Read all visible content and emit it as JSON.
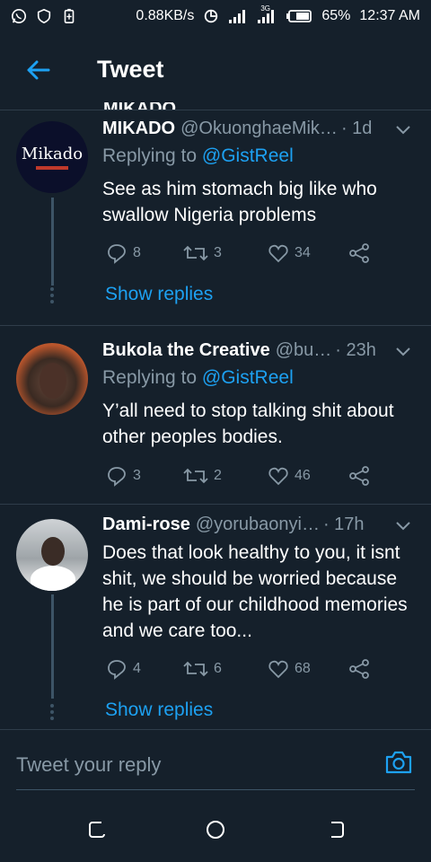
{
  "status_bar": {
    "left_icons": [
      "whatsapp-icon",
      "shield-icon",
      "battery-saver-icon"
    ],
    "net_speed": "0.88KB/s",
    "network_label": "3G",
    "battery": "65%",
    "time": "12:37 AM"
  },
  "header": {
    "title": "Tweet",
    "back_icon": "arrow-left-icon"
  },
  "partial_above": "MIKADO",
  "tweets": [
    {
      "name": "MIKADO",
      "handle": "@OkuonghaeMik…",
      "time": "· 1d",
      "reply_prefix": "Replying to ",
      "reply_mention": "@GistReel",
      "text": "See as him stomach big like who swallow Nigeria problems",
      "avatar_text": "Mikado",
      "replies": "8",
      "retweets": "3",
      "likes": "34",
      "show_replies": "Show replies"
    },
    {
      "name": "Bukola the Creative",
      "handle": "@bu…",
      "time": "· 23h",
      "reply_prefix": "Replying to ",
      "reply_mention": "@GistReel",
      "text": "Y’all need to stop talking shit about other peoples bodies.",
      "replies": "3",
      "retweets": "2",
      "likes": "46"
    },
    {
      "name": "Dami-rose",
      "handle": "@yorubaonyi…",
      "time": "· 17h",
      "text": "Does that look healthy to you, it isnt shit, we should be worried because he is part of our childhood memories and we care too...",
      "replies": "4",
      "retweets": "6",
      "likes": "68",
      "show_replies": "Show replies"
    }
  ],
  "reply_bar": {
    "placeholder": "Tweet your reply",
    "camera_icon": "camera-icon"
  },
  "colors": {
    "background": "#15202b",
    "accent": "#1da1f2",
    "muted": "#8899a6"
  }
}
